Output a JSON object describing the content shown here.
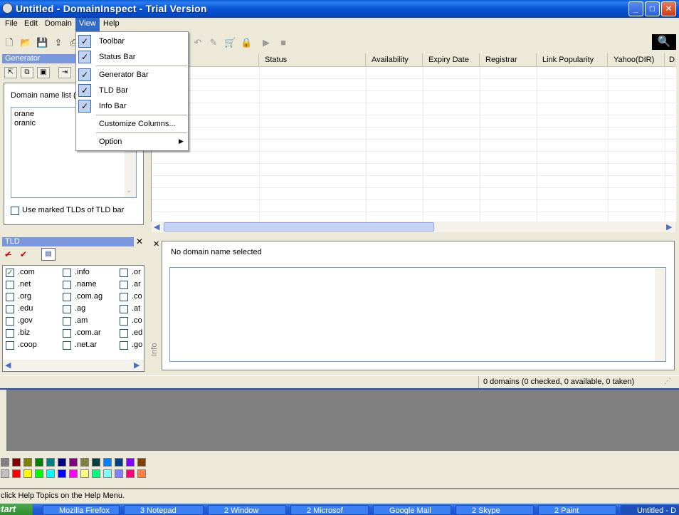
{
  "window": {
    "title": "Untitled - DomainInspect - Trial Version"
  },
  "menubar": [
    "File",
    "Edit",
    "Domain",
    "View",
    "Help"
  ],
  "view_menu": {
    "items": [
      {
        "label": "Toolbar",
        "checked": true
      },
      {
        "label": "Status Bar",
        "checked": true
      },
      {
        "label": "Generator Bar",
        "checked": true
      },
      {
        "label": "TLD Bar",
        "checked": true
      },
      {
        "label": "Info Bar",
        "checked": true
      },
      {
        "label": "Customize Columns...",
        "checked": false
      },
      {
        "label": "Option",
        "checked": false,
        "submenu": true
      }
    ]
  },
  "generator": {
    "header": "Generator",
    "list_label": "Domain name list (c",
    "names": [
      "orane",
      "oranic"
    ],
    "use_marked_label": "Use marked TLDs of TLD bar"
  },
  "tld": {
    "header": "TLD",
    "columns": [
      [
        {
          "label": ".com",
          "checked": true
        },
        {
          "label": ".net",
          "checked": false
        },
        {
          "label": ".org",
          "checked": false
        },
        {
          "label": ".edu",
          "checked": false
        },
        {
          "label": ".gov",
          "checked": false
        },
        {
          "label": ".biz",
          "checked": false
        },
        {
          "label": ".coop",
          "checked": false
        }
      ],
      [
        {
          "label": ".info",
          "checked": false
        },
        {
          "label": ".name",
          "checked": false
        },
        {
          "label": ".com.ag",
          "checked": false
        },
        {
          "label": ".ag",
          "checked": false
        },
        {
          "label": ".am",
          "checked": false
        },
        {
          "label": ".com.ar",
          "checked": false
        },
        {
          "label": ".net.ar",
          "checked": false
        }
      ],
      [
        {
          "label": ".or",
          "checked": false
        },
        {
          "label": ".ar",
          "checked": false
        },
        {
          "label": ".co",
          "checked": false
        },
        {
          "label": ".at",
          "checked": false
        },
        {
          "label": ".co",
          "checked": false
        },
        {
          "label": ".ed",
          "checked": false
        },
        {
          "label": ".go",
          "checked": false
        }
      ]
    ]
  },
  "grid": {
    "columns": [
      "ame",
      "Status",
      "Availability",
      "Expiry Date",
      "Registrar",
      "Link Popularity",
      "Yahoo(DIR)",
      "DI"
    ]
  },
  "info": {
    "side_label": "Info",
    "message": "No domain name selected"
  },
  "status": {
    "text": "0 domains (0 checked, 0 available, 0 taken)"
  },
  "paint": {
    "help_text": "click Help Topics on the Help Menu.",
    "palette_top": [
      "#808080",
      "#800000",
      "#808000",
      "#008000",
      "#008080",
      "#000080",
      "#800080",
      "#808040",
      "#004040",
      "#0080ff",
      "#004080",
      "#8000ff",
      "#804000"
    ],
    "palette_bottom": [
      "#c0c0c0",
      "#ff0000",
      "#ffff00",
      "#00ff00",
      "#00ffff",
      "#0000ff",
      "#ff00ff",
      "#ffff80",
      "#00ff80",
      "#80ffff",
      "#8080ff",
      "#ff0080",
      "#ff8040"
    ]
  },
  "taskbar": {
    "start": "start",
    "items": [
      "Mozilla Firefox",
      "3 Notepad",
      "2 Window",
      "2 Microsof",
      "Google Mail",
      "2 Skype",
      "2 Paint",
      "Untitled - D"
    ]
  }
}
